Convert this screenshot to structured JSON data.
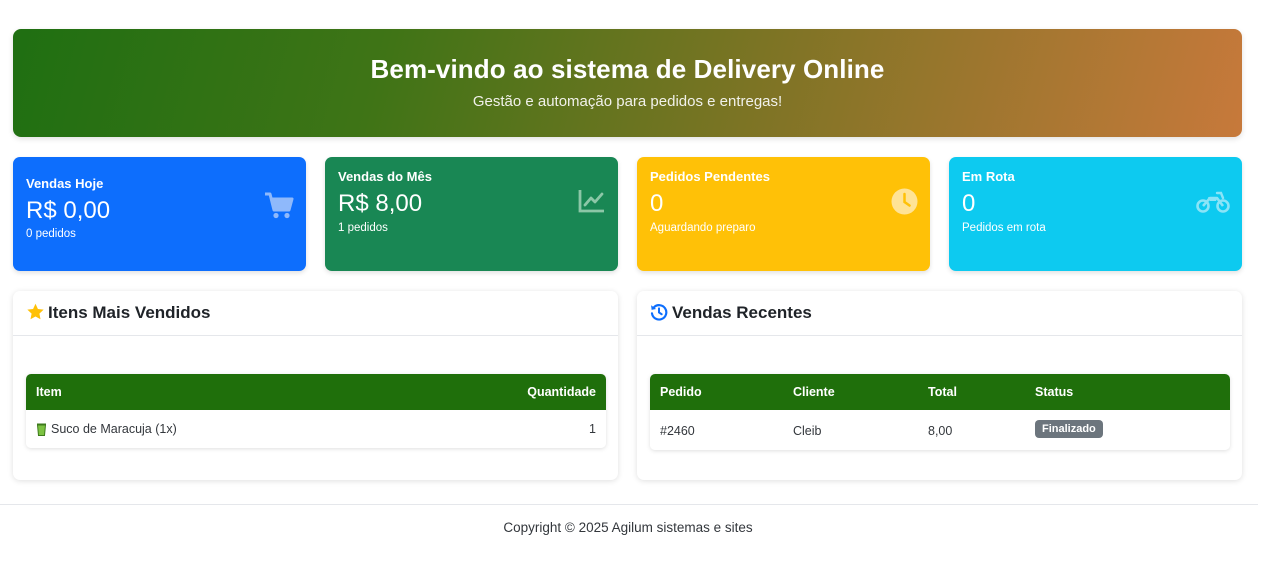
{
  "hero": {
    "title": "Bem-vindo ao sistema de Delivery Online",
    "subtitle": "Gestão e automação para pedidos e entregas!"
  },
  "stats": [
    {
      "label": "Vendas Hoje",
      "value": "R$ 0,00",
      "sub": "0 pedidos",
      "icon": "cart-icon",
      "color": "#0d6efd"
    },
    {
      "label": "Vendas do Mês",
      "value": "R$ 8,00",
      "sub": "1 pedidos",
      "icon": "chart-line-icon",
      "color": "#198754"
    },
    {
      "label": "Pedidos Pendentes",
      "value": "0",
      "sub": "Aguardando preparo",
      "icon": "clock-icon",
      "color": "#ffc107"
    },
    {
      "label": "Em Rota",
      "value": "0",
      "sub": "Pedidos em rota",
      "icon": "motorcycle-icon",
      "color": "#0dcaf0"
    }
  ],
  "top_items": {
    "title": "Itens Mais Vendidos",
    "icon": "star-icon",
    "columns": [
      "Item",
      "Quantidade"
    ],
    "rows": [
      {
        "item": "Suco de Maracuja (1x)",
        "quantity": "1"
      }
    ]
  },
  "recent_sales": {
    "title": "Vendas Recentes",
    "icon": "history-icon",
    "columns": [
      "Pedido",
      "Cliente",
      "Total",
      "Status"
    ],
    "rows": [
      {
        "order": "#2460",
        "client": "Cleib",
        "total": "8,00",
        "status": "Finalizado"
      }
    ]
  },
  "footer": {
    "text": "Copyright © 2025 Agilum sistemas e sites"
  },
  "colors": {
    "table_header": "#1f6f0b",
    "badge": "#6c757d"
  }
}
